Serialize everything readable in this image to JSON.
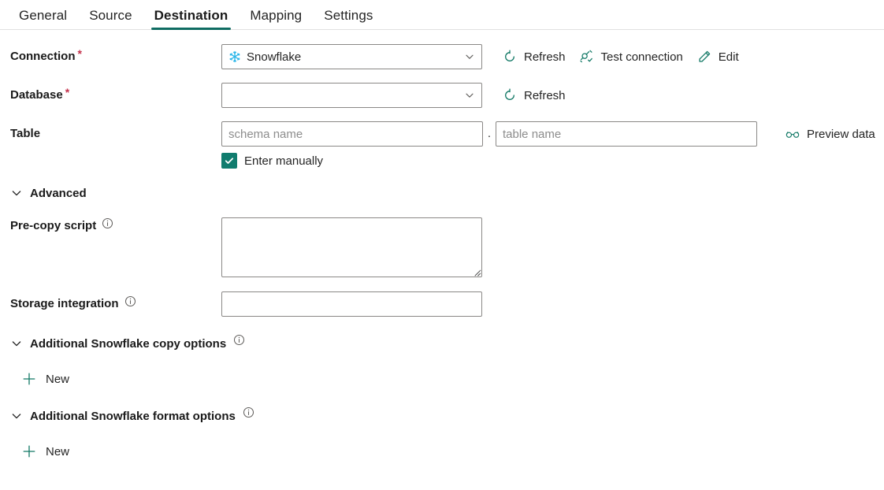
{
  "tabs": [
    {
      "label": "General",
      "active": false
    },
    {
      "label": "Source",
      "active": false
    },
    {
      "label": "Destination",
      "active": true
    },
    {
      "label": "Mapping",
      "active": false
    },
    {
      "label": "Settings",
      "active": false
    }
  ],
  "colors": {
    "accent_teal": "#0f6c62",
    "icon_teal": "#117865",
    "checkbox_green": "#107c6e",
    "required_red": "#c4314b",
    "snowflake_blue": "#29b5e8",
    "border_gray": "#8a8886",
    "placeholder_gray": "#8d8d8d"
  },
  "connection": {
    "label": "Connection",
    "required_marker": "*",
    "value": "Snowflake",
    "icon": "snowflake-icon",
    "dropdown_icon": "chevron-down-icon",
    "actions": [
      {
        "label": "Refresh",
        "icon": "refresh-icon"
      },
      {
        "label": "Test connection",
        "icon": "plug-check-icon"
      },
      {
        "label": "Edit",
        "icon": "pencil-icon"
      }
    ]
  },
  "database": {
    "label": "Database",
    "required_marker": "*",
    "value": "",
    "placeholder": "",
    "dropdown_icon": "chevron-down-icon",
    "actions": [
      {
        "label": "Refresh",
        "icon": "refresh-icon"
      }
    ]
  },
  "table": {
    "label": "Table",
    "schema_placeholder": "schema name",
    "schema_value": "",
    "separator": ".",
    "table_placeholder": "table name",
    "table_value": "",
    "preview": {
      "label": "Preview data",
      "icon": "glasses-icon"
    },
    "enter_manually": {
      "label": "Enter manually",
      "checked": true,
      "icon": "checkmark-icon"
    }
  },
  "advanced": {
    "label": "Advanced",
    "expanded": true,
    "caret_icon": "chevron-down-icon"
  },
  "precopy": {
    "label": "Pre-copy script",
    "info_icon": "info-icon",
    "value": "",
    "placeholder": ""
  },
  "storage_integration": {
    "label": "Storage integration",
    "info_icon": "info-icon",
    "value": "",
    "placeholder": ""
  },
  "copy_options": {
    "label": "Additional Snowflake copy options",
    "info_icon": "info-icon",
    "caret_icon": "chevron-down-icon",
    "expanded": true,
    "new_button": {
      "label": "New",
      "icon": "plus-icon"
    }
  },
  "format_options": {
    "label": "Additional Snowflake format options",
    "info_icon": "info-icon",
    "caret_icon": "chevron-down-icon",
    "expanded": true,
    "new_button": {
      "label": "New",
      "icon": "plus-icon"
    }
  }
}
